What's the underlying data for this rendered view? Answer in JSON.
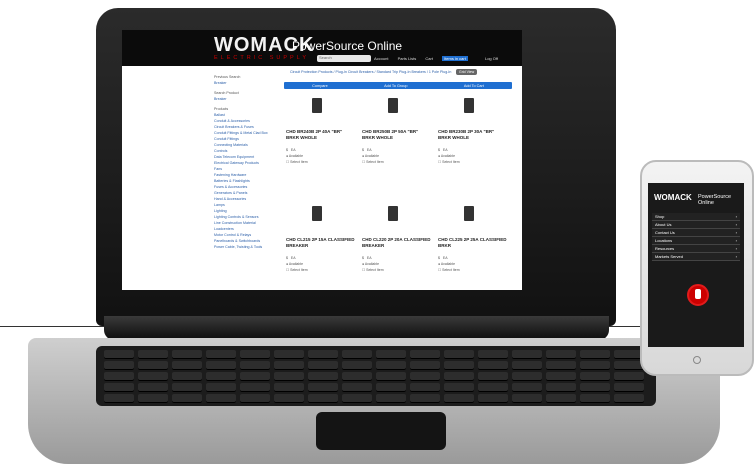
{
  "site": {
    "logo": "WOMACK",
    "logo_sub": "ELECTRIC SUPPLY",
    "tagline": "PowerSource Online",
    "search_placeholder": "Search",
    "nav": [
      {
        "label": "Account"
      },
      {
        "label": "Parts Lists"
      },
      {
        "label": "Cart",
        "highlight": "Items in cart"
      },
      {
        "label": "Log Off"
      }
    ],
    "breadcrumb": "Circuit Protection Products / Plug-In Circuit Breakers / Standard Trip Plug-In Breakers / 1 Pole Plug-In",
    "view_pill": "Grid View",
    "actions": [
      "Compare",
      "Add To Group",
      "Add To Cart"
    ],
    "sidebar": {
      "sections": [
        {
          "head": "Previous Search",
          "items": [
            "Breaker"
          ]
        },
        {
          "head": "Search Product",
          "items": [
            "Breaker"
          ]
        },
        {
          "head": "Products",
          "items": [
            "Ballast",
            "Conduit & Accessories",
            "Circuit Breakers & Fuses",
            "Conduit Fittings & Metal Clad Box",
            "Conduit Fittings",
            "Connecting Materials",
            "Controls",
            "Data Telecom Equipment",
            "Electrical Gateway Products",
            "Fans",
            "Fastening Hardware",
            "Batteries & Flashlights",
            "Fuses & Accessories",
            "Generators & Panels",
            "Hand & Accessories",
            "Lamps",
            "Lighting",
            "Lighting Controls & Sensors",
            "Line Construction Material",
            "Loadcenters",
            "Motor Control & Relays",
            "Panelboards & Switchboards",
            "Power Cable, Twisting & Tools"
          ]
        }
      ]
    },
    "products": [
      {
        "title": "CHD BR240B 2P 40A \"BR\" BRKR WHOLE"
      },
      {
        "title": "CHD BR250B 2P 50A \"BR\" BRKR WHOLE"
      },
      {
        "title": "CHD BR230B 2P 30A \"BR\" BRKR WHOLE"
      },
      {
        "title": "CHD CL215 2P 15A CLASSIFIED BREAKER"
      },
      {
        "title": "CHD CL220 2P 20A CLASSIFIED BREAKER"
      },
      {
        "title": "CHD CL225 2P 25A CLASSIFIED BRKR"
      }
    ],
    "product_meta": {
      "qty_symbol": "$",
      "unit": "EA",
      "availability": "Available",
      "select": "Select Item"
    }
  },
  "phone": {
    "logo": "WOMACK",
    "tagline": "PowerSource Online",
    "menu": [
      "Shop",
      "About Us",
      "Contact Us",
      "Locations",
      "Resources",
      "Markets Served"
    ]
  }
}
